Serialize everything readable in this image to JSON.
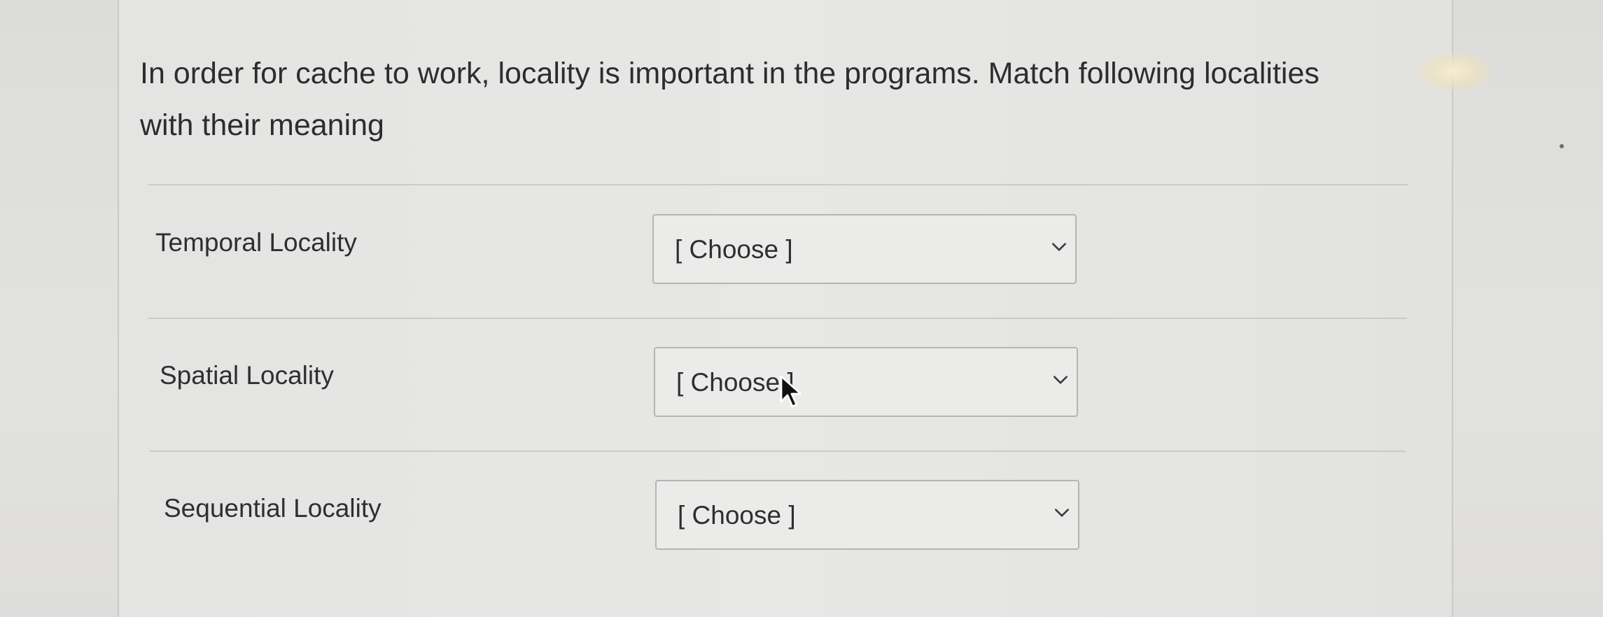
{
  "question": {
    "line1": "In order for cache to work, locality is important in the programs. Match following localities",
    "line2": "with their meaning"
  },
  "rows": [
    {
      "label": "Temporal Locality",
      "selected": "[ Choose ]"
    },
    {
      "label": "Spatial Locality",
      "selected": "[ Choose ]"
    },
    {
      "label": "Sequential Locality",
      "selected": "[ Choose ]"
    }
  ],
  "icons": {
    "dropdown": "chevron-down-icon",
    "pointer": "mouse-cursor-icon"
  },
  "colors": {
    "text": "#2d2f33",
    "card_background": "#e6e6e4",
    "select_border": "#b4b5b4",
    "divider": "#cacac8"
  }
}
